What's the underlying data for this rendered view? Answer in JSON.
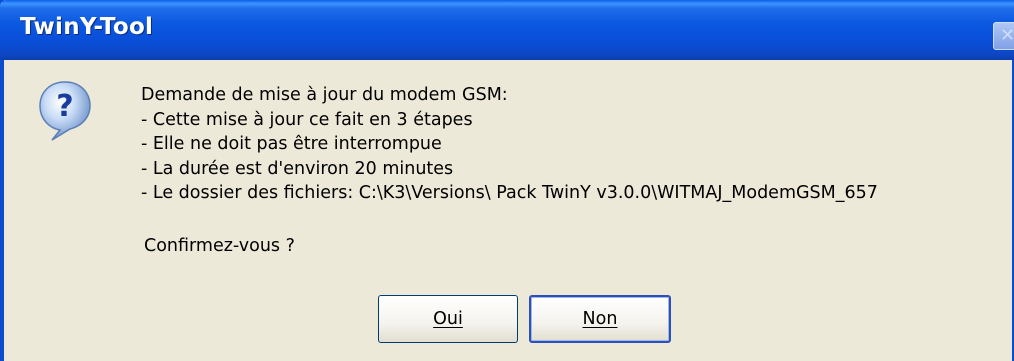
{
  "dialog": {
    "title": "TwinY-Tool",
    "icon": "question-icon",
    "message_lines": [
      "Demande de mise à jour du modem GSM:",
      "- Cette mise à jour ce fait en 3 étapes",
      "- Elle ne doit pas être interrompue",
      "- La durée est d'environ 20 minutes",
      "- Le dossier des fichiers: C:\\K3\\Versions\\ Pack TwinY v3.0.0\\WITMAJ_ModemGSM_657"
    ],
    "confirm_text": "Confirmez-vous ?",
    "buttons": {
      "yes_label": "Oui",
      "no_label": "Non"
    }
  },
  "colors": {
    "titlebar": "#0a4ed8",
    "dialog_bg": "#ece9d8",
    "button_focus_border": "#2d4fb8"
  }
}
